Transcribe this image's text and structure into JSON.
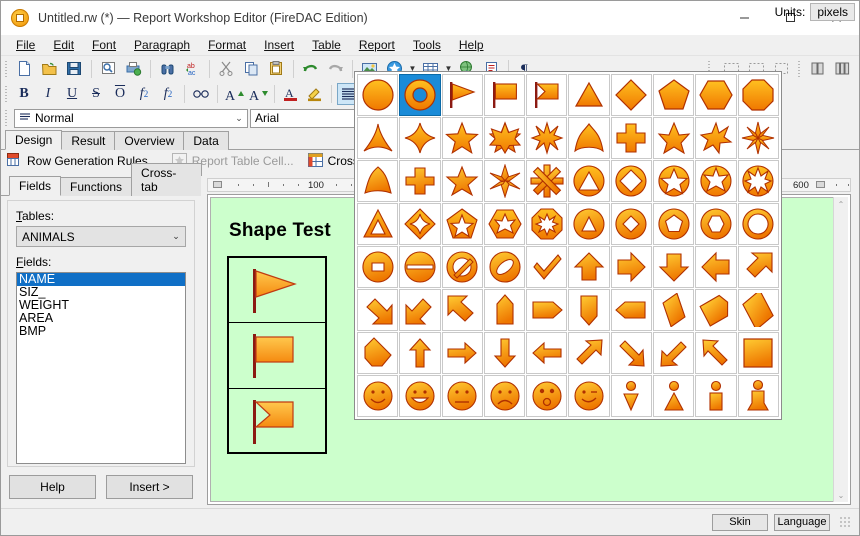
{
  "window": {
    "title": "Untitled.rw (*) — Report Workshop Editor (FireDAC Edition)",
    "app_icon": "report-app-icon",
    "minimize": "minimize-icon",
    "maximize": "maximize-icon",
    "close": "close-icon"
  },
  "menu": {
    "items": [
      {
        "label": "File"
      },
      {
        "label": "Edit"
      },
      {
        "label": "Font"
      },
      {
        "label": "Paragraph"
      },
      {
        "label": "Format"
      },
      {
        "label": "Insert"
      },
      {
        "label": "Table"
      },
      {
        "label": "Report"
      },
      {
        "label": "Tools"
      },
      {
        "label": "Help"
      }
    ]
  },
  "toolbar_main": {
    "buttons": [
      {
        "name": "new-document-icon"
      },
      {
        "name": "open-folder-icon"
      },
      {
        "name": "save-disk-icon"
      },
      {
        "name": "print-preview-icon"
      },
      {
        "name": "print-icon"
      },
      {
        "name": "find-binoculars-icon"
      },
      {
        "name": "replace-abc-icon"
      },
      {
        "name": "cut-scissors-icon"
      },
      {
        "name": "copy-icon"
      },
      {
        "name": "paste-clipboard-icon"
      },
      {
        "name": "undo-arrow-icon"
      },
      {
        "name": "redo-arrow-icon"
      },
      {
        "name": "insert-picture-icon"
      },
      {
        "name": "insert-shape-star-icon"
      },
      {
        "name": "insert-table-icon"
      },
      {
        "name": "insert-hyperlink-icon"
      },
      {
        "name": "insert-object-icon"
      },
      {
        "name": "show-paragraph-marks-icon"
      }
    ],
    "right_buttons": [
      {
        "name": "frame-none-icon"
      },
      {
        "name": "frame-single-icon"
      },
      {
        "name": "frame-double-icon"
      },
      {
        "name": "columns-two-icon"
      },
      {
        "name": "columns-three-icon"
      }
    ]
  },
  "toolbar_format": {
    "buttons": [
      {
        "name": "bold-button",
        "glyph": "B"
      },
      {
        "name": "italic-button",
        "glyph": "I"
      },
      {
        "name": "underline-button",
        "glyph": "U"
      },
      {
        "name": "strikeout-button",
        "glyph": "S"
      },
      {
        "name": "overline-button",
        "glyph": "O"
      },
      {
        "name": "subscript-button",
        "glyph": "f2"
      },
      {
        "name": "superscript-button",
        "glyph": "f2"
      },
      {
        "name": "hidden-text-button",
        "glyph": "glasses"
      },
      {
        "name": "grow-font-button",
        "glyph": "A"
      },
      {
        "name": "shrink-font-button",
        "glyph": "A"
      },
      {
        "name": "font-color-button",
        "glyph": "A"
      },
      {
        "name": "highlight-button",
        "glyph": "pen"
      },
      {
        "name": "align-justify-button",
        "glyph": "lines"
      }
    ]
  },
  "style_combo": {
    "value": "Normal",
    "icon": "paragraph-style-icon"
  },
  "font_combo": {
    "value": "Arial"
  },
  "units": {
    "label": "Units:",
    "value": "pixels"
  },
  "tabs": {
    "items": [
      {
        "label": "Design",
        "active": true
      },
      {
        "label": "Result",
        "active": false
      },
      {
        "label": "Overview",
        "active": false
      },
      {
        "label": "Data",
        "active": false
      }
    ]
  },
  "action_row": {
    "items": [
      {
        "label": "Row Generation Rules...",
        "icon": "table-rules-icon",
        "disabled": false
      },
      {
        "label": "Report Table Cell...",
        "icon": "star-cell-icon",
        "disabled": true
      },
      {
        "label": "Cross Tabulation",
        "icon": "cross-tab-icon",
        "disabled": false
      }
    ]
  },
  "left_panel": {
    "tabs": [
      {
        "label": "Fields",
        "active": true
      },
      {
        "label": "Functions",
        "active": false
      },
      {
        "label": "Cross-tab",
        "active": false
      }
    ],
    "tables_label": "Tables:",
    "tables_value": "ANIMALS",
    "fields_label": "Fields:",
    "fields": [
      {
        "label": "NAME",
        "selected": true
      },
      {
        "label": "SIZ_",
        "selected": false
      },
      {
        "label": "WEIGHT",
        "selected": false
      },
      {
        "label": "AREA",
        "selected": false
      },
      {
        "label": "BMP",
        "selected": false
      }
    ],
    "help_button": "Help",
    "insert_button": "Insert >"
  },
  "ruler": {
    "labels": [
      "100",
      "600"
    ],
    "marker": "left-indent-marker"
  },
  "document": {
    "title": "Shape Test",
    "page_color": "#ccffcc",
    "shapes": [
      {
        "name": "pennant-flag-shape"
      },
      {
        "name": "rectangle-flag-shape"
      },
      {
        "name": "swallowtail-flag-shape"
      }
    ]
  },
  "palette": {
    "accent_fill_top": "#ffc020",
    "accent_fill_bottom": "#f07800",
    "accent_stroke": "#b03000",
    "selection_color": "#1a8bd8",
    "selected_index": 1,
    "shapes": [
      "circle",
      "donut-ring",
      "pennant-flag",
      "rectangle-flag",
      "swallowtail-flag",
      "triangle",
      "diamond",
      "pentagon",
      "hexagon",
      "octagon",
      "three-point-concave-star",
      "four-point-star",
      "five-point-star",
      "six-point-star",
      "eight-point-star",
      "three-lobe-blob",
      "cross-plus",
      "five-arm-star",
      "six-arm-star",
      "eight-arm-star",
      "three-lobe-rounded",
      "thick-cross",
      "five-arm-thick-star",
      "six-arm-thick-star",
      "eight-arm-spoke",
      "circle-triangle-cut",
      "circle-diamond-cut",
      "circle-star-cut",
      "circle-six-star-cut",
      "circle-eight-star-cut",
      "triangle-outline-cut",
      "diamond-four-star-cut",
      "pentagon-star-cut",
      "hexagon-six-star-cut",
      "octagon-eight-star-cut",
      "circle-triangle-hole",
      "circle-diamond-hole",
      "circle-pentagon-hole",
      "circle-hexagon-hole",
      "circle-ring-hole",
      "circle-rect-hole",
      "circle-minus-bar",
      "no-entry-slash",
      "no-entry-ellipse",
      "checkmark",
      "up-arrow-block",
      "right-arrow-block",
      "down-arrow-block",
      "left-arrow-block",
      "northeast-arrow-block",
      "southeast-arrow-block",
      "southwest-arrow-block",
      "northwest-arrow-block",
      "up-pentagon-arrow",
      "right-pentagon-arrow",
      "down-pentagon-arrow",
      "left-pentagon-arrow",
      "right-slanted-tag",
      "left-slanted-tag",
      "rhombus-tag",
      "angled-tag",
      "thin-up-arrow",
      "thin-right-arrow",
      "thin-down-arrow",
      "thin-left-arrow",
      "thin-northeast-arrow",
      "thin-southeast-arrow",
      "thin-southwest-arrow",
      "thin-northwest-arrow",
      "square",
      "smiley-face",
      "grin-face",
      "neutral-face",
      "sad-face",
      "surprised-face",
      "wink-face",
      "person-triangle-down",
      "person-triangle-up",
      "person-rect-body",
      "person-skirt-body"
    ]
  },
  "statusbar": {
    "skin_button": "Skin",
    "language_button": "Language",
    "resize_grip": "resize-grip-icon"
  }
}
